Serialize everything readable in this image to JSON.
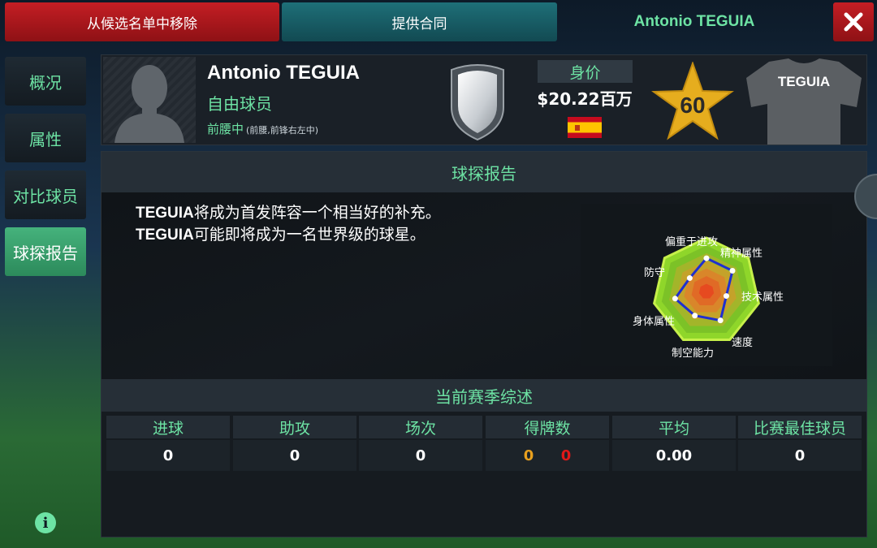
{
  "top_bar": {
    "remove_label": "从候选名单中移除",
    "offer_label": "提供合同",
    "player_name": "Antonio TEGUIA"
  },
  "nav": [
    {
      "label": "概况",
      "active": false
    },
    {
      "label": "属性",
      "active": false
    },
    {
      "label": "对比球员",
      "active": false
    },
    {
      "label": "球探报告",
      "active": true
    }
  ],
  "player": {
    "name": "Antonio TEGUIA",
    "status": "自由球员",
    "position": "前腰中",
    "position_alt": "(前腰,前锋右左中)",
    "value_label": "身价",
    "value": "$20.22百万",
    "nationality_flag": "spain-flag",
    "rating": "60",
    "shirt_name": "TEGUIA"
  },
  "scout_report": {
    "title": "球探报告",
    "lines": [
      {
        "name": "TEGUIA",
        "text": "将成为首发阵容一个相当好的补充。"
      },
      {
        "name": "TEGUIA",
        "text": "可能即将成为一名世界级的球星。"
      }
    ],
    "radar_labels": [
      "偏重于进攻",
      "精神属性",
      "技术属性",
      "速度",
      "制空能力",
      "身体属性",
      "防守"
    ],
    "radar_values": [
      0.62,
      0.62,
      0.38,
      0.6,
      0.5,
      0.6,
      0.4
    ]
  },
  "season": {
    "title": "当前赛季综述",
    "stats": [
      {
        "label": "进球",
        "value": "0"
      },
      {
        "label": "助攻",
        "value": "0"
      },
      {
        "label": "场次",
        "value": "0"
      },
      {
        "label": "得牌数",
        "yellow": "0",
        "red": "0"
      },
      {
        "label": "平均",
        "value": "0.00"
      },
      {
        "label": "比赛最佳球员",
        "value": "0"
      }
    ]
  },
  "colors": {
    "accent_green": "#6de3a4",
    "button_red": "#c41e24",
    "button_teal": "#1e6f78",
    "star_gold": "#e6ad1e",
    "yellow_card": "#e8a01e",
    "red_card": "#e01818"
  }
}
